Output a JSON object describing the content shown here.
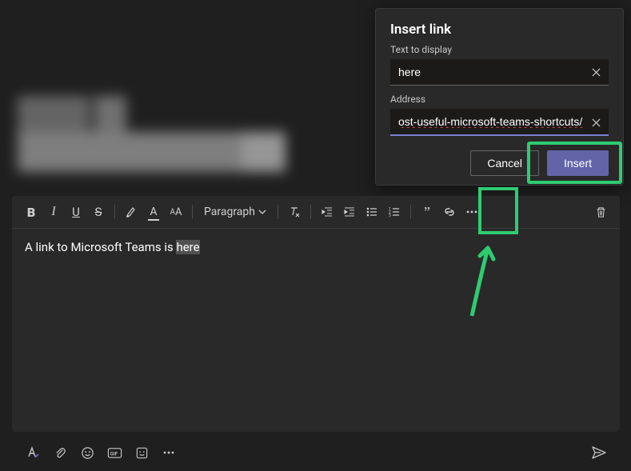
{
  "dialog": {
    "title": "Insert link",
    "text_label": "Text to display",
    "text_value": "here",
    "address_label": "Address",
    "address_value": "ost-useful-microsoft-teams-shortcuts/",
    "cancel_label": "Cancel",
    "insert_label": "Insert"
  },
  "toolbar": {
    "paragraph_label": "Paragraph"
  },
  "compose": {
    "body_prefix": "A link to Microsoft Teams is ",
    "body_selected": "here"
  }
}
